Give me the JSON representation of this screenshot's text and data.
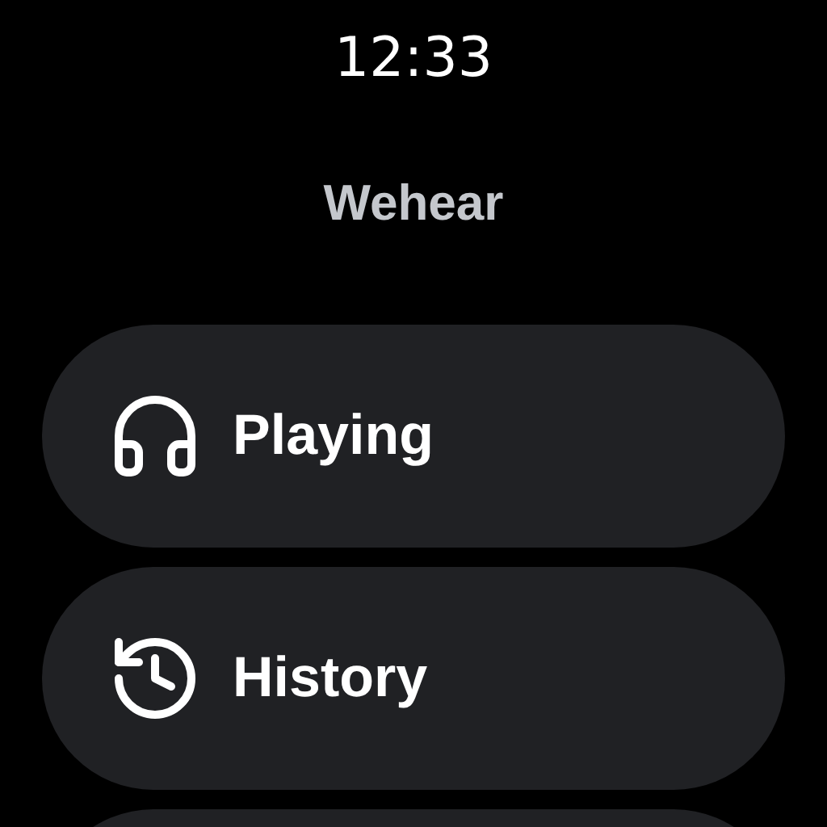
{
  "status_bar": {
    "time": "12:33"
  },
  "title": "Wehear",
  "menu": [
    {
      "kind": "headphones",
      "label": "Playing"
    },
    {
      "kind": "history",
      "label": "History"
    },
    {
      "kind": "hidden"
    }
  ]
}
